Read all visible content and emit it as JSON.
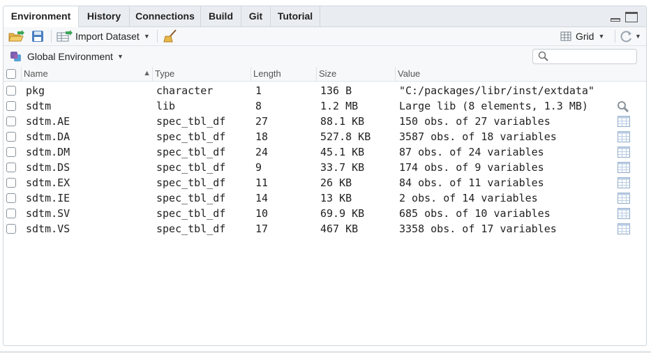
{
  "tabs": [
    {
      "label": "Environment",
      "active": true
    },
    {
      "label": "History",
      "active": false
    },
    {
      "label": "Connections",
      "active": false
    },
    {
      "label": "Build",
      "active": false
    },
    {
      "label": "Git",
      "active": false
    },
    {
      "label": "Tutorial",
      "active": false
    }
  ],
  "toolbar": {
    "import_label": "Import Dataset",
    "view_label": "Grid"
  },
  "env": {
    "label": "Global Environment",
    "search_placeholder": ""
  },
  "columns": [
    "Name",
    "Type",
    "Length",
    "Size",
    "Value"
  ],
  "rows": [
    {
      "name": "pkg",
      "type": "character",
      "length": "1",
      "size": "136 B",
      "value": "\"C:/packages/libr/inst/extdata\"",
      "icon": "none"
    },
    {
      "name": "sdtm",
      "type": "lib",
      "length": "8",
      "size": "1.2 MB",
      "value": "Large lib (8 elements, 1.3 MB)",
      "icon": "magnifier-icon"
    },
    {
      "name": "sdtm.AE",
      "type": "spec_tbl_df",
      "length": "27",
      "size": "88.1 KB",
      "value": "150 obs. of 27 variables",
      "icon": "table-icon"
    },
    {
      "name": "sdtm.DA",
      "type": "spec_tbl_df",
      "length": "18",
      "size": "527.8 KB",
      "value": "3587 obs. of 18 variables",
      "icon": "table-icon"
    },
    {
      "name": "sdtm.DM",
      "type": "spec_tbl_df",
      "length": "24",
      "size": "45.1 KB",
      "value": "87 obs. of 24 variables",
      "icon": "table-icon"
    },
    {
      "name": "sdtm.DS",
      "type": "spec_tbl_df",
      "length": "9",
      "size": "33.7 KB",
      "value": "174 obs. of 9 variables",
      "icon": "table-icon"
    },
    {
      "name": "sdtm.EX",
      "type": "spec_tbl_df",
      "length": "11",
      "size": "26 KB",
      "value": "84 obs. of 11 variables",
      "icon": "table-icon"
    },
    {
      "name": "sdtm.IE",
      "type": "spec_tbl_df",
      "length": "14",
      "size": "13 KB",
      "value": "2 obs. of 14 variables",
      "icon": "table-icon"
    },
    {
      "name": "sdtm.SV",
      "type": "spec_tbl_df",
      "length": "10",
      "size": "69.9 KB",
      "value": "685 obs. of 10 variables",
      "icon": "table-icon"
    },
    {
      "name": "sdtm.VS",
      "type": "spec_tbl_df",
      "length": "17",
      "size": "467 KB",
      "value": "3358 obs. of 17 variables",
      "icon": "table-icon"
    }
  ],
  "colors": {
    "accent": "#4a7fc1",
    "border": "#cfd6dd",
    "toolbar_bg": "#f7f8f9"
  }
}
